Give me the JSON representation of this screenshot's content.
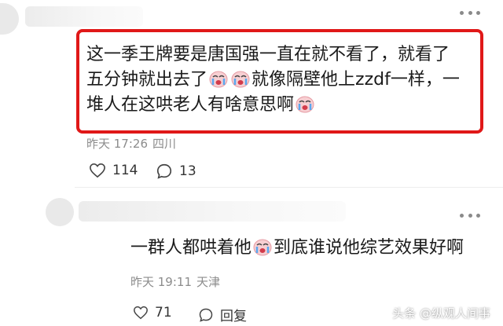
{
  "comments": [
    {
      "text_lines": [
        "这一季王牌要是唐国强一直在就不看了，就看了",
        "五分钟就出去了",
        "就像隔壁他上zzdf一样，一",
        "堆人在这哄老人有啥意思啊"
      ],
      "time": "昨天 17:26",
      "location": "四川",
      "likes": "114",
      "replies": "13",
      "emoji": "crying-face"
    },
    {
      "text_before": "一群人都哄着他",
      "text_after": "到底谁说他综艺效果好啊",
      "time": "昨天 19:11",
      "location": "天津",
      "likes": "71",
      "reply_label": "回复",
      "emoji": "crying-face"
    }
  ],
  "watermark": "头条 @纵观人间事",
  "colors": {
    "highlight": "#e01818",
    "meta": "#8c8c8c"
  }
}
